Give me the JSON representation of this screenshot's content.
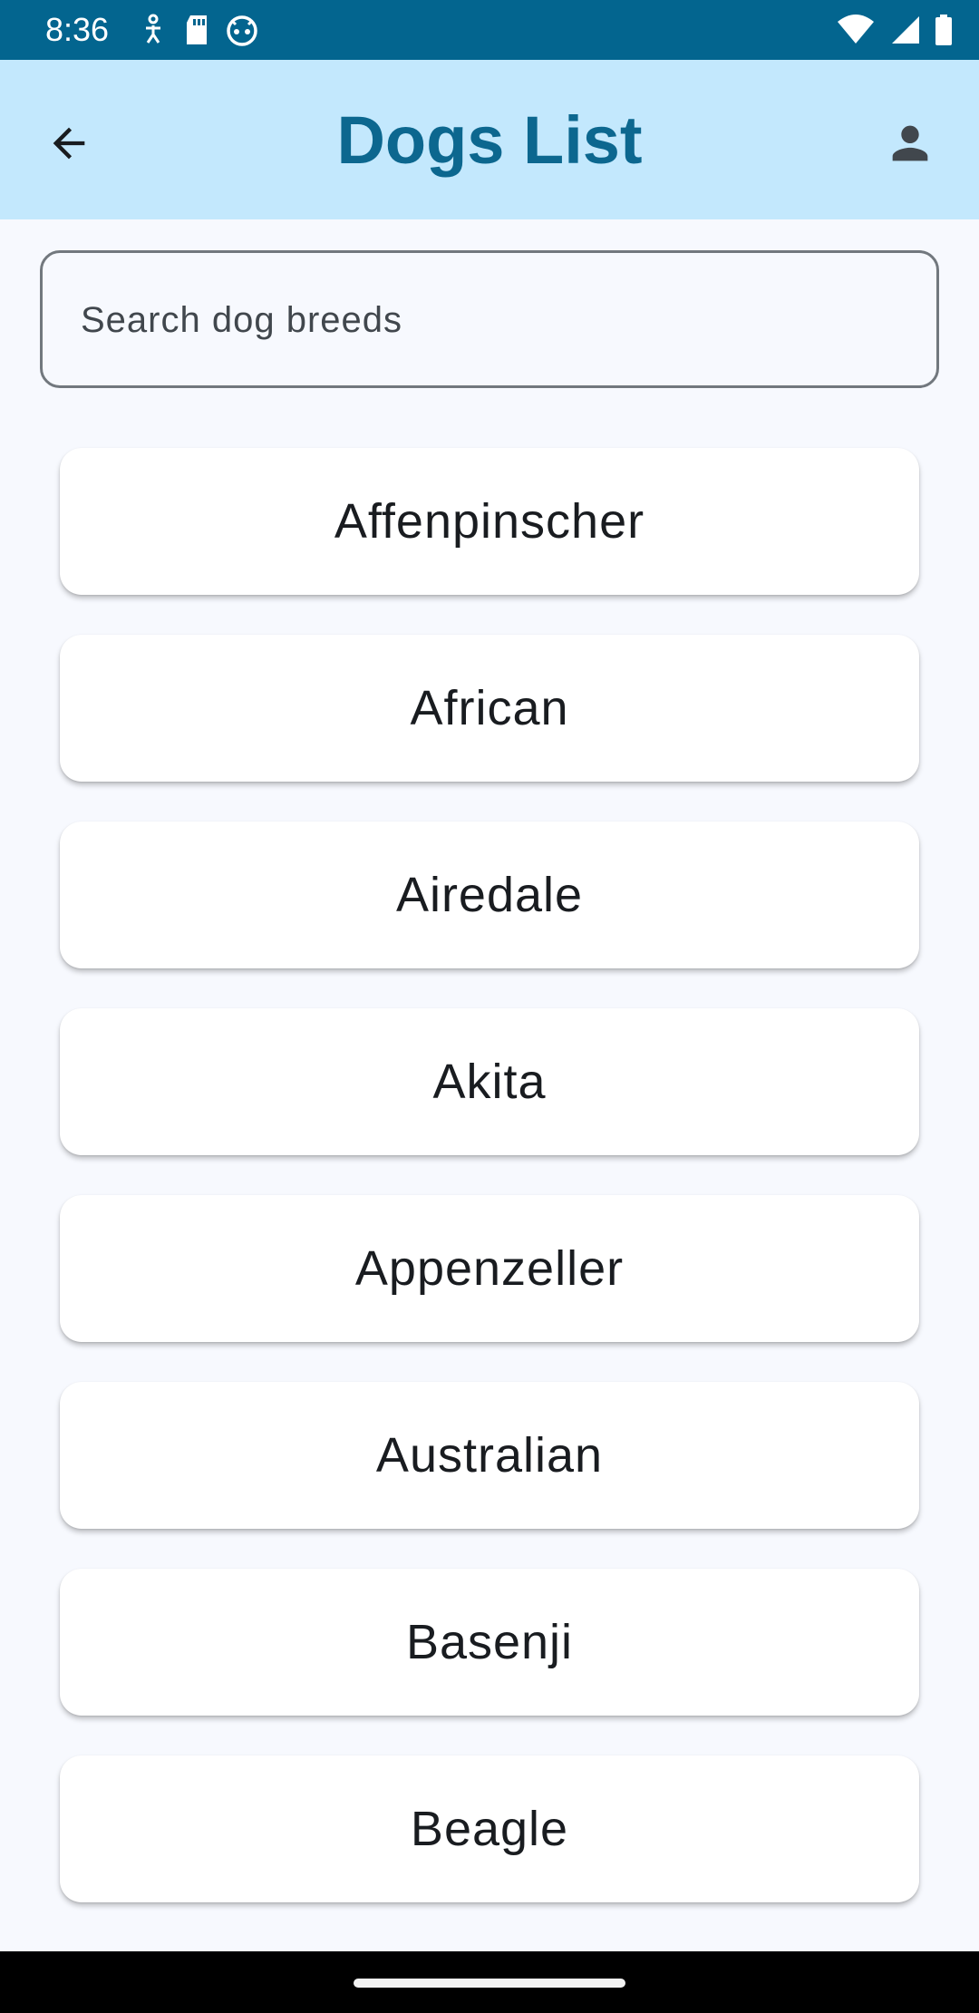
{
  "status_bar": {
    "time": "8:36",
    "background_color": "#03658f",
    "left_icons": [
      "accessibility-icon",
      "sd-card-icon",
      "android-face-icon"
    ],
    "right_icons": [
      "wifi-icon",
      "signal-icon",
      "battery-icon"
    ]
  },
  "app_bar": {
    "title": "Dogs List",
    "back_icon": "arrow-back-icon",
    "profile_icon": "person-icon",
    "background_color": "#c3e8fd",
    "title_color": "#0c678f"
  },
  "search": {
    "placeholder": "Search dog breeds",
    "value": ""
  },
  "breeds": [
    {
      "name": "Affenpinscher"
    },
    {
      "name": "African"
    },
    {
      "name": "Airedale"
    },
    {
      "name": "Akita"
    },
    {
      "name": "Appenzeller"
    },
    {
      "name": "Australian"
    },
    {
      "name": "Basenji"
    },
    {
      "name": "Beagle"
    }
  ]
}
